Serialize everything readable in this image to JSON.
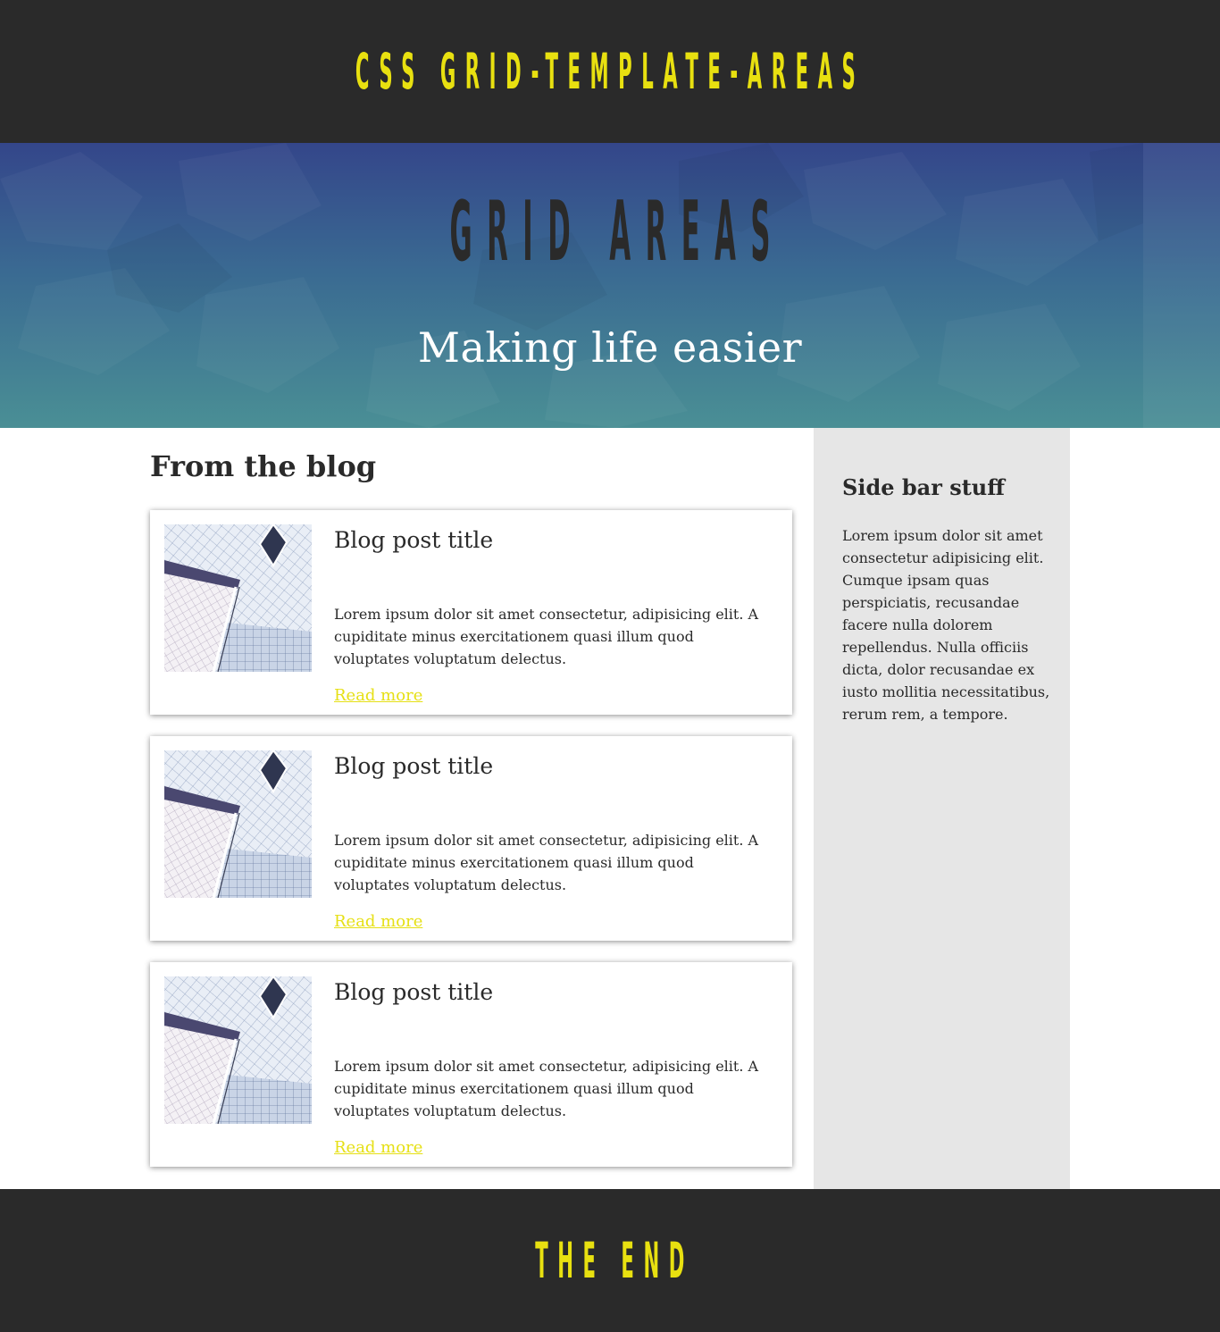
{
  "header": {
    "title": "CSS GRID-TEMPLATE-AREAS"
  },
  "hero": {
    "title": "GRID AREAS",
    "subtitle": "Making life easier"
  },
  "main": {
    "heading": "From the blog",
    "posts": [
      {
        "title": "Blog post title",
        "excerpt": "Lorem ipsum dolor sit amet consectetur, adipisicing elit. A cupiditate minus exercitationem quasi illum quod voluptates voluptatum delectus.",
        "link_label": "Read more",
        "image_icon": "building-photo"
      },
      {
        "title": "Blog post title",
        "excerpt": "Lorem ipsum dolor sit amet consectetur, adipisicing elit. A cupiditate minus exercitationem quasi illum quod voluptates voluptatum delectus.",
        "link_label": "Read more",
        "image_icon": "building-photo"
      },
      {
        "title": "Blog post title",
        "excerpt": "Lorem ipsum dolor sit amet consectetur, adipisicing elit. A cupiditate minus exercitationem quasi illum quod voluptates voluptatum delectus.",
        "link_label": "Read more",
        "image_icon": "building-photo"
      }
    ]
  },
  "sidebar": {
    "heading": "Side bar stuff",
    "text": "Lorem ipsum dolor sit amet consectetur adipisicing elit. Cumque ipsam quas perspiciatis, recusandae facere nulla dolorem repellendus. Nulla officiis dicta, dolor recusandae ex iusto mollitia necessitatibus, rerum rem, a tempore."
  },
  "footer": {
    "title": "THE END"
  },
  "colors": {
    "dark": "#2a2a2a",
    "accent_yellow": "#e8e010",
    "sidebar_bg": "#e6e6e6",
    "hero_top": "#34468a",
    "hero_bottom": "#4a8f95"
  }
}
